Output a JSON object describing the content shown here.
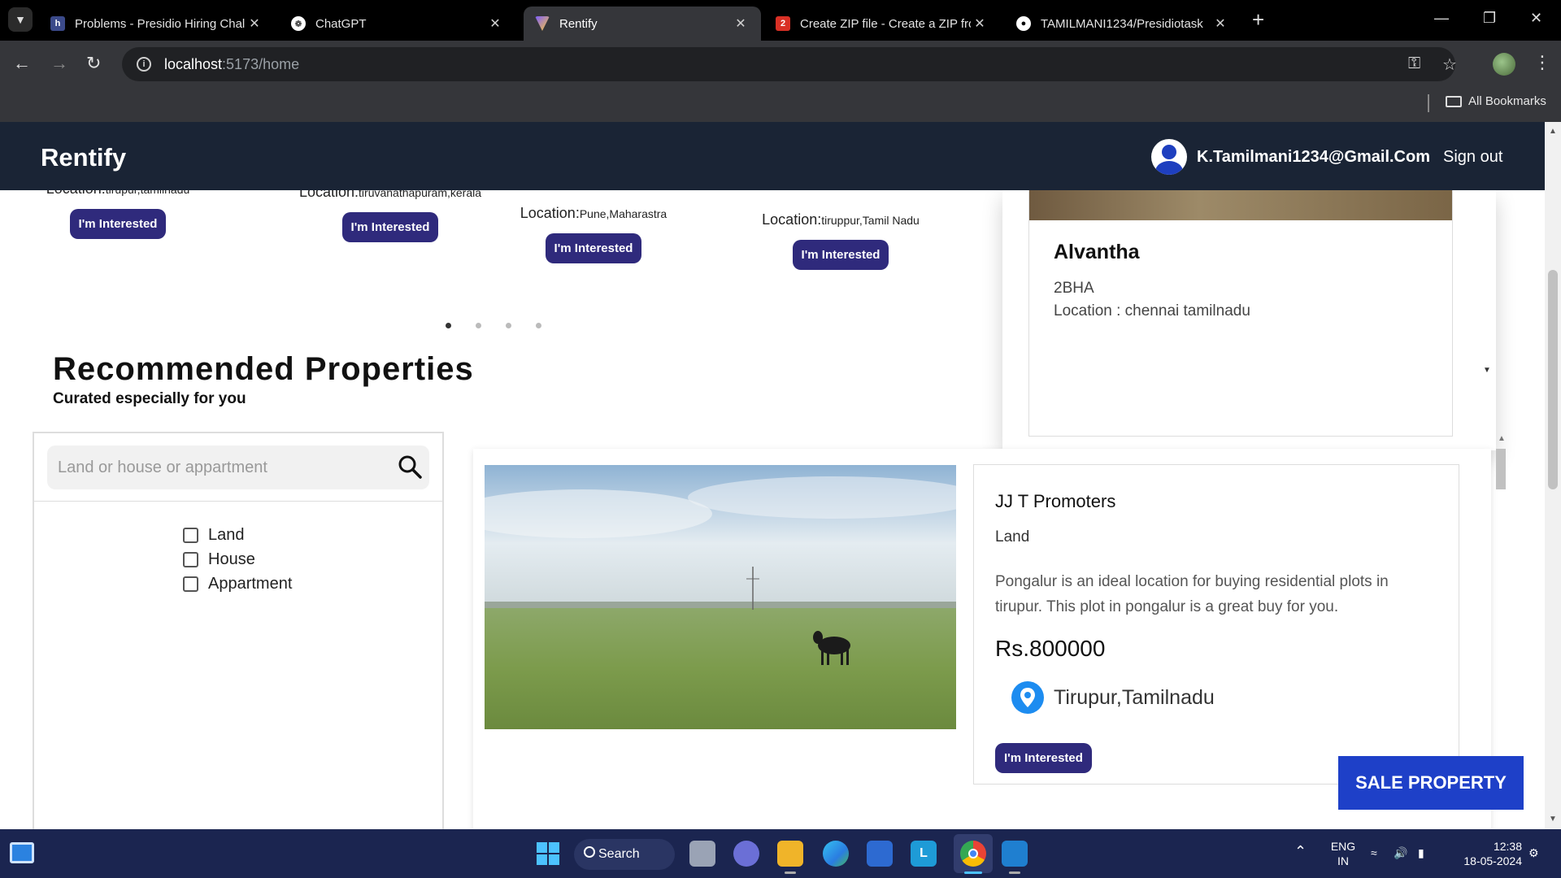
{
  "browser": {
    "tabs": [
      {
        "title": "Problems - Presidio Hiring Chall",
        "active": false
      },
      {
        "title": "ChatGPT",
        "active": false
      },
      {
        "title": "Rentify",
        "active": true
      },
      {
        "title": "Create ZIP file - Create a ZIP fro",
        "active": false
      },
      {
        "title": "TAMILMANI1234/Presidiotask",
        "active": false
      }
    ],
    "url_host": "localhost",
    "url_path": ":5173/home",
    "bookmarks_label": "All Bookmarks"
  },
  "header": {
    "brand": "Rentify",
    "user_email": "K.Tamilmani1234@Gmail.Com",
    "signout": "Sign out"
  },
  "carousel": {
    "cards": [
      {
        "loc_label": "Location:",
        "loc_value": "tirupur,tamilnadu",
        "button": "I'm Interested"
      },
      {
        "loc_label": "Location:",
        "loc_value": "tiruvanathapuram,kerala",
        "button": "I'm Interested"
      },
      {
        "loc_label": "Location:",
        "loc_value": "Pune,Maharastra",
        "button": "I'm Interested"
      },
      {
        "loc_label": "Location:",
        "loc_value": "tiruppur,Tamil Nadu",
        "button": "I'm Interested"
      }
    ],
    "dot_count": 4,
    "active_dot": 0
  },
  "side_listing": {
    "name": "Alvantha",
    "type": "2BHA",
    "location": "Location : chennai tamilnadu"
  },
  "recommended": {
    "title": "Recommended Properties",
    "subtitle": "Curated especially for you"
  },
  "filter": {
    "search_placeholder": "Land or house or appartment",
    "options": [
      "Land",
      "House",
      "Appartment"
    ]
  },
  "property": {
    "name": "JJ T Promoters",
    "type": "Land",
    "description": "Pongalur is an ideal location for buying residential plots in tirupur. This plot in pongalur is a great buy for you.",
    "price": "Rs.800000",
    "location": "Tirupur,Tamilnadu",
    "button": "I'm Interested"
  },
  "sale_button": "SALE PROPERTY",
  "taskbar": {
    "search": "Search",
    "lang_top": "ENG",
    "lang_bottom": "IN",
    "time": "12:38",
    "date": "18-05-2024"
  }
}
